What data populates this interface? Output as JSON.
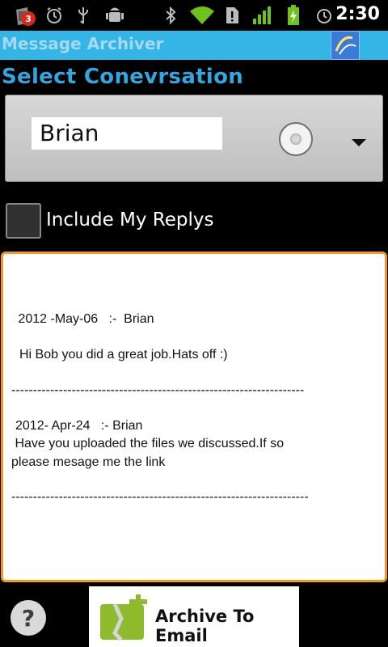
{
  "status_bar": {
    "notification_count": "3",
    "time": "2:30"
  },
  "app": {
    "title": "Message Archiver"
  },
  "main": {
    "section_heading": "Select Conevrsation",
    "selected_contact": "Brian",
    "include_replies_label": "Include My Replys",
    "messages": [
      {
        "date_line": " 2012 -May-06   :-  Brian",
        "body": "Hi Bob you did a great job.Hats off :)"
      },
      {
        "date_line": "2012- Apr-24   :- Brian",
        "body_line1": " Have you uploaded the files we discussed.If so",
        "body_line2": "please mesage me the link"
      }
    ],
    "separator": "--------------------------------------------------------------------",
    "separator2": "---------------------------------------------------------------------"
  },
  "footer": {
    "help_label": "?",
    "archive_label": "Archive To Email"
  },
  "colors": {
    "title_bar": "#33b5e5",
    "heading": "#2fa8df",
    "message_border": "#f39a1e"
  }
}
